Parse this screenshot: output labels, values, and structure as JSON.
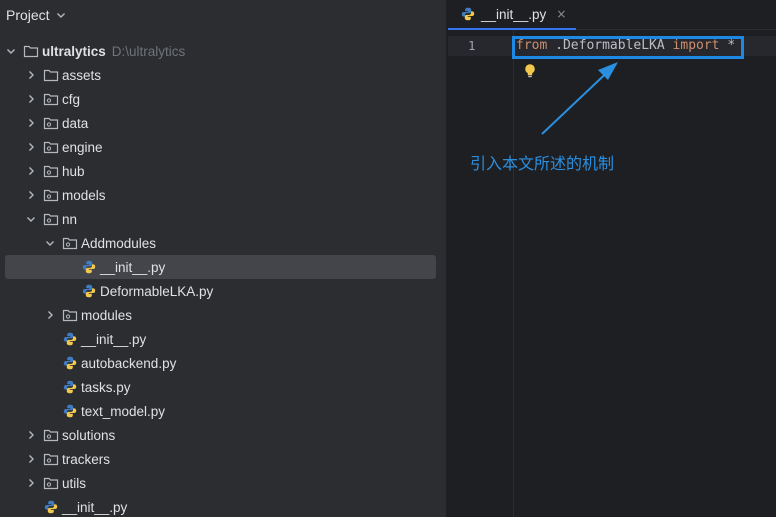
{
  "panel": {
    "title": "Project"
  },
  "tree": {
    "root": {
      "label": "ultralytics",
      "path": "D:\\ultralytics"
    },
    "items": [
      {
        "label": "assets"
      },
      {
        "label": "cfg"
      },
      {
        "label": "data"
      },
      {
        "label": "engine"
      },
      {
        "label": "hub"
      },
      {
        "label": "models"
      },
      {
        "label": "nn"
      },
      {
        "label": "Addmodules"
      },
      {
        "label": "__init__.py"
      },
      {
        "label": "DeformableLKA.py"
      },
      {
        "label": "modules"
      },
      {
        "label": "__init__.py"
      },
      {
        "label": "autobackend.py"
      },
      {
        "label": "tasks.py"
      },
      {
        "label": "text_model.py"
      },
      {
        "label": "solutions"
      },
      {
        "label": "trackers"
      },
      {
        "label": "utils"
      },
      {
        "label": "__init__.py"
      }
    ]
  },
  "editor": {
    "tab_label": "__init__.py",
    "close_glyph": "×",
    "line_number": "1",
    "code": {
      "kw_from": "from",
      "module": " .DeformableLKA ",
      "kw_import": "import",
      "star": " *"
    },
    "annotation": "引入本文所述的机制"
  },
  "colors": {
    "accent": "#3574f0",
    "highlight_box": "#1e88e5",
    "annotation": "#2b8fe0",
    "keyword": "#cf8e6d",
    "python_blue": "#3f7cc2",
    "python_yellow": "#f2c94c"
  }
}
